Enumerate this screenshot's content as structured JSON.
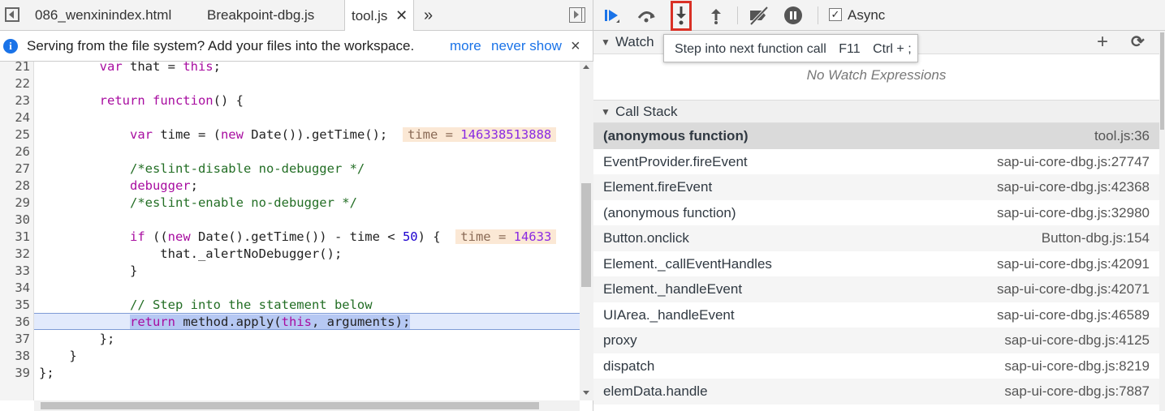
{
  "tabs": [
    {
      "label": "086_wenxinindex.html"
    },
    {
      "label": "Breakpoint-dbg.js"
    },
    {
      "label": "tool.js"
    }
  ],
  "tab_overflow": "»",
  "infobar": {
    "message": "Serving from the file system? Add your files into the workspace.",
    "more": "more",
    "never_show": "never show",
    "close": "×"
  },
  "code": {
    "line_numbers": [
      "21",
      "22",
      "23",
      "24",
      "25",
      "26",
      "27",
      "28",
      "29",
      "30",
      "31",
      "32",
      "33",
      "34",
      "35",
      "36",
      "37",
      "38",
      "39"
    ],
    "l21_a": "        var ",
    "l21_b": "that = ",
    "l21_c": "this",
    "l21_d": ";",
    "l23_a": "        return ",
    "l23_b": "function",
    "l23_c": "() {",
    "l25_a": "            var ",
    "l25_b": "time = (",
    "l25_c": "new ",
    "l25_d": "Date()).getTime();",
    "l25_inline_k": "time = ",
    "l25_inline_v": "146338513888",
    "l27": "            /*eslint-disable no-debugger */",
    "l28_a": "            ",
    "l28_b": "debugger",
    "l28_c": ";",
    "l29": "            /*eslint-enable no-debugger */",
    "l31_a": "            if ",
    "l31_b": "((",
    "l31_c": "new ",
    "l31_d": "Date().getTime()) - time < ",
    "l31_e": "50",
    "l31_f": ") {",
    "l31_inline_k": "time = ",
    "l31_inline_v": "14633",
    "l32": "                that._alertNoDebugger();",
    "l33": "            }",
    "l35": "            // Step into the statement below",
    "l36_a": "            ",
    "l36_b": "return",
    "l36_c": " method.apply(",
    "l36_d": "this",
    "l36_e": ", arguments);",
    "l37": "        };",
    "l38": "    }",
    "l39": "};"
  },
  "toolbar": {
    "async_label": "Async",
    "async_checked": true
  },
  "tooltip": {
    "text": "Step into next function call",
    "shortcut1": "F11",
    "shortcut2": "Ctrl + ;"
  },
  "watch": {
    "title": "Watch",
    "empty": "No Watch Expressions",
    "add": "+",
    "refresh": "⟳"
  },
  "call_stack": {
    "title": "Call Stack",
    "frames": [
      {
        "name": "(anonymous function)",
        "location": "tool.js:36"
      },
      {
        "name": "EventProvider.fireEvent",
        "location": "sap-ui-core-dbg.js:27747"
      },
      {
        "name": "Element.fireEvent",
        "location": "sap-ui-core-dbg.js:42368"
      },
      {
        "name": "(anonymous function)",
        "location": "sap-ui-core-dbg.js:32980"
      },
      {
        "name": "Button.onclick",
        "location": "Button-dbg.js:154"
      },
      {
        "name": "Element._callEventHandles",
        "location": "sap-ui-core-dbg.js:42091"
      },
      {
        "name": "Element._handleEvent",
        "location": "sap-ui-core-dbg.js:42071"
      },
      {
        "name": "UIArea._handleEvent",
        "location": "sap-ui-core-dbg.js:46589"
      },
      {
        "name": "proxy",
        "location": "sap-ui-core-dbg.js:4125"
      },
      {
        "name": "dispatch",
        "location": "sap-ui-core-dbg.js:8219"
      },
      {
        "name": "elemData.handle",
        "location": "sap-ui-core-dbg.js:7887"
      }
    ]
  },
  "colors": {
    "accent": "#1a73e8",
    "highlight_border": "#d93025",
    "exec_line": "#e2eafc"
  }
}
